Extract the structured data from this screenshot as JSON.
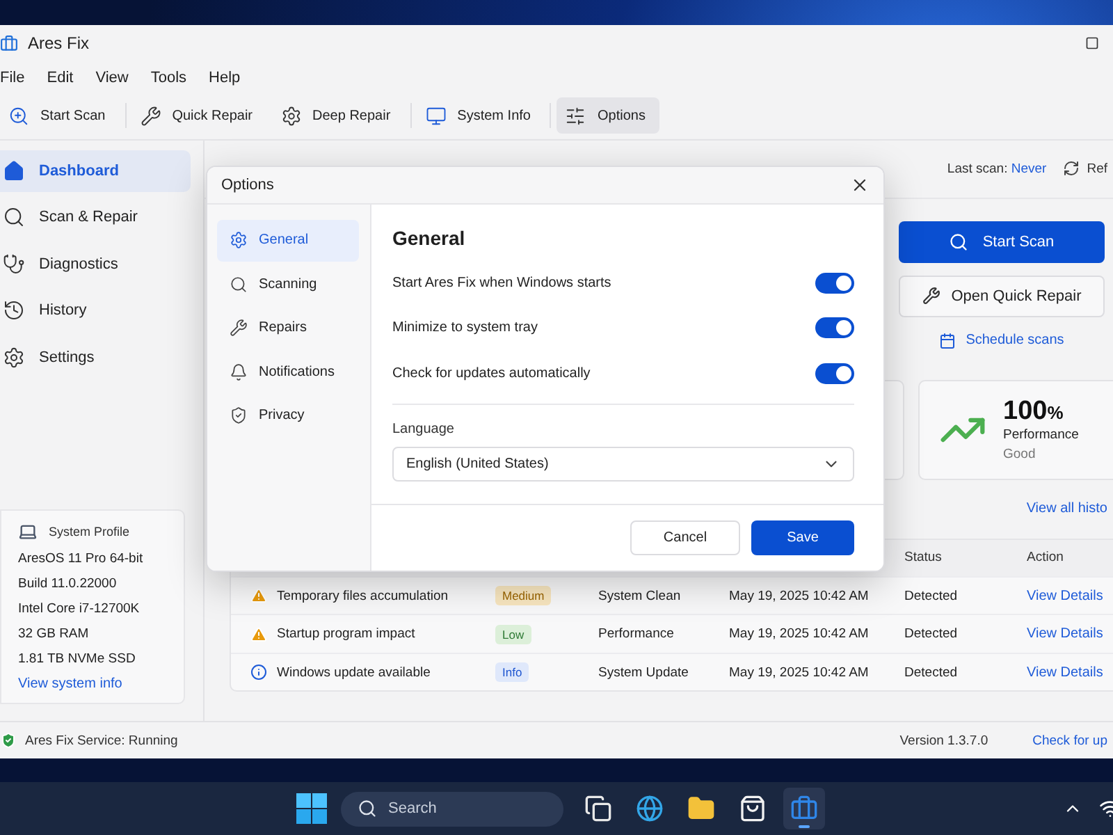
{
  "window": {
    "title": "Ares Fix"
  },
  "menu": [
    "File",
    "Edit",
    "View",
    "Tools",
    "Help"
  ],
  "toolbar": [
    {
      "kind": "scan",
      "label": "Start Scan",
      "selected": false
    },
    {
      "kind": "quick",
      "label": "Quick Repair",
      "selected": false
    },
    {
      "kind": "deep",
      "label": "Deep Repair",
      "selected": false
    },
    {
      "kind": "info",
      "label": "System Info",
      "selected": false
    },
    {
      "kind": "options",
      "label": "Options",
      "selected": true
    }
  ],
  "sidebar": {
    "items": [
      {
        "kind": "home",
        "label": "Dashboard",
        "selected": true
      },
      {
        "kind": "scan",
        "label": "Scan & Repair",
        "selected": false
      },
      {
        "kind": "diag",
        "label": "Diagnostics",
        "selected": false
      },
      {
        "kind": "history",
        "label": "History",
        "selected": false
      },
      {
        "kind": "settings",
        "label": "Settings",
        "selected": false
      }
    ],
    "profile": {
      "title": "System Profile",
      "lines": [
        "AresOS 11 Pro 64-bit",
        "Build 11.0.22000",
        "Intel Core i7-12700K",
        "32 GB RAM",
        "1.81 TB NVMe SSD"
      ],
      "link": "View system info"
    }
  },
  "main": {
    "last_scan_label": "Last scan:",
    "last_scan_value": "Never",
    "refresh": "Ref",
    "start_button": "Start Scan",
    "quick_button": "Open Quick Repair",
    "schedule_link": "Schedule scans",
    "stat": {
      "value": "100",
      "unit": "%",
      "label": "Performance",
      "status": "Good"
    },
    "history_link": "View all histo",
    "table": {
      "columns": [
        "Status",
        "Action"
      ],
      "rows": [
        {
          "kind": "warning",
          "issue": "Temporary files accumulation",
          "severity": {
            "kind": "medium",
            "label": "Medium"
          },
          "category": "System Clean",
          "date": "May 19, 2025 10:42 AM",
          "status": "Detected",
          "action": "View Details"
        },
        {
          "kind": "warning",
          "issue": "Startup program impact",
          "severity": {
            "kind": "low",
            "label": "Low"
          },
          "category": "Performance",
          "date": "May 19, 2025 10:42 AM",
          "status": "Detected",
          "action": "View Details"
        },
        {
          "kind": "info",
          "issue": "Windows update available",
          "severity": {
            "kind": "info",
            "label": "Info"
          },
          "category": "System Update",
          "date": "May 19, 2025 10:42 AM",
          "status": "Detected",
          "action": "View Details"
        }
      ]
    }
  },
  "status_bar": {
    "service": "Ares Fix Service: Running",
    "version": "Version 1.3.7.0",
    "update_link": "Check for up"
  },
  "dialog": {
    "title": "Options",
    "nav": [
      {
        "kind": "general",
        "label": "General",
        "selected": true
      },
      {
        "kind": "scanning",
        "label": "Scanning",
        "selected": false
      },
      {
        "kind": "repairs",
        "label": "Repairs",
        "selected": false
      },
      {
        "kind": "notifications",
        "label": "Notifications",
        "selected": false
      },
      {
        "kind": "privacy",
        "label": "Privacy",
        "selected": false
      }
    ],
    "heading": "General",
    "settings": [
      {
        "label": "Start Ares Fix when Windows starts",
        "on": true
      },
      {
        "label": "Minimize to system tray",
        "on": true
      },
      {
        "label": "Check for updates automatically",
        "on": true
      }
    ],
    "language": {
      "label": "Language",
      "value": "English (United States)"
    },
    "cancel": "Cancel",
    "save": "Save"
  },
  "taskbar": {
    "search_placeholder": "Search",
    "apps": [
      {
        "kind": "taskview",
        "active": false
      },
      {
        "kind": "edge",
        "active": false
      },
      {
        "kind": "explorer",
        "active": false
      },
      {
        "kind": "store",
        "active": false
      },
      {
        "kind": "aresfix",
        "active": true
      }
    ]
  }
}
